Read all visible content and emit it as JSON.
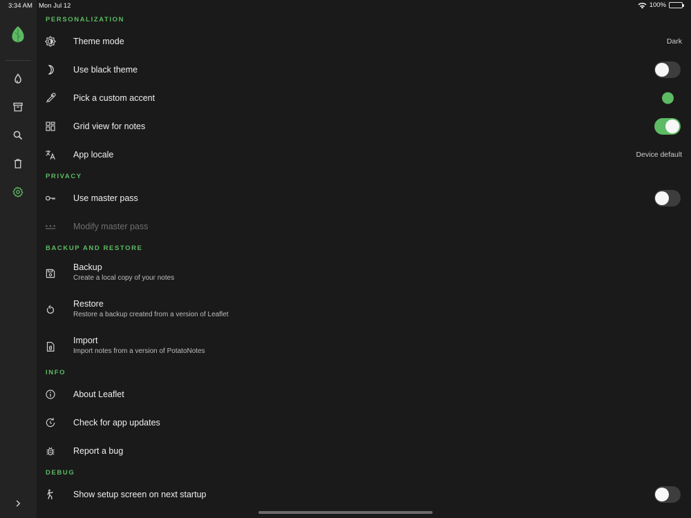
{
  "status_bar": {
    "time": "3:34 AM",
    "date": "Mon Jul 12",
    "battery": "100%"
  },
  "colors": {
    "accent": "#5dbb63",
    "background": "#1a1a1a",
    "rail": "#232323"
  },
  "rail": {
    "items": [
      {
        "name": "notes",
        "icon": "water-drop-icon"
      },
      {
        "name": "archive",
        "icon": "archive-icon"
      },
      {
        "name": "search",
        "icon": "search-icon"
      },
      {
        "name": "trash",
        "icon": "trash-icon"
      },
      {
        "name": "settings",
        "icon": "gear-icon",
        "selected": true
      }
    ],
    "expand_icon": "chevron-right-icon"
  },
  "settings": {
    "personalization": {
      "header": "PERSONALIZATION",
      "theme_mode": {
        "title": "Theme mode",
        "value": "Dark",
        "icon": "theme-icon"
      },
      "black_theme": {
        "title": "Use black theme",
        "enabled": false,
        "icon": "moon-icon"
      },
      "custom_accent": {
        "title": "Pick a custom accent",
        "color": "#5dbb63",
        "icon": "eyedropper-icon"
      },
      "grid_view": {
        "title": "Grid view for notes",
        "enabled": true,
        "icon": "grid-icon"
      },
      "app_locale": {
        "title": "App locale",
        "value": "Device default",
        "icon": "translate-icon"
      }
    },
    "privacy": {
      "header": "PRIVACY",
      "master_pass": {
        "title": "Use master pass",
        "enabled": false,
        "icon": "key-icon"
      },
      "modify_master_pass": {
        "title": "Modify master pass",
        "disabled": true,
        "icon": "password-dots-icon"
      }
    },
    "backup": {
      "header": "BACKUP AND RESTORE",
      "backup": {
        "title": "Backup",
        "subtitle": "Create a local copy of your notes",
        "icon": "save-icon"
      },
      "restore": {
        "title": "Restore",
        "subtitle": "Restore a backup created from a version of Leaflet",
        "icon": "restore-icon"
      },
      "import": {
        "title": "Import",
        "subtitle": "Import notes from a version of PotatoNotes",
        "icon": "file-import-icon"
      }
    },
    "info": {
      "header": "INFO",
      "about": {
        "title": "About Leaflet",
        "icon": "info-icon"
      },
      "updates": {
        "title": "Check for app updates",
        "icon": "update-icon"
      },
      "report_bug": {
        "title": "Report a bug",
        "icon": "bug-icon"
      }
    },
    "debug": {
      "header": "DEBUG",
      "setup_screen": {
        "title": "Show setup screen on next startup",
        "enabled": false,
        "icon": "person-walking-icon"
      }
    }
  }
}
